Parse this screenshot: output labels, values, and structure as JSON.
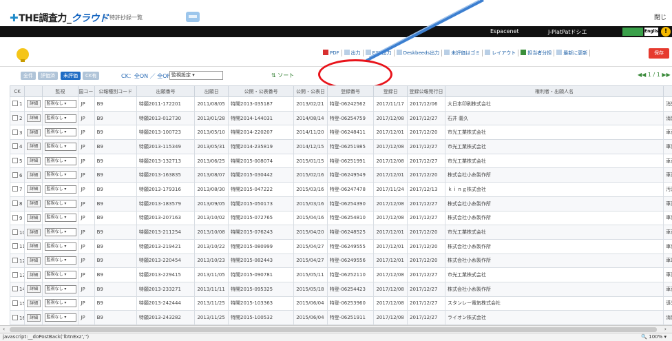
{
  "header": {
    "logo_prefix": "✚",
    "logo_main": "THE調査力_",
    "logo_cloud": "クラウド",
    "subtitle": "特許抄録一覧",
    "close": "閉じ"
  },
  "linkbar": {
    "espacenet": "Espacenet",
    "jplat": "J-PlatPatドシエ",
    "english": "English",
    "help": "!"
  },
  "actions": [
    {
      "icon": "pdf-icon",
      "label": "PDF"
    },
    {
      "icon": "output-icon",
      "label": "出力"
    },
    {
      "icon": "exz-icon",
      "label": "EXZ出力"
    },
    {
      "icon": "deskbeeds-icon",
      "label": "Deskbeeds出力"
    },
    {
      "icon": "trash-icon",
      "label": "未評価はゴミ"
    },
    {
      "icon": "layout-icon",
      "label": "レイアウト"
    },
    {
      "icon": "report-icon",
      "label": "担当者分担"
    },
    {
      "icon": "refresh-icon",
      "label": "最新に更新"
    }
  ],
  "save_label": "保存",
  "filter": {
    "tabs": [
      "全件",
      "評価済",
      "未評価",
      "CK有"
    ],
    "active_tab": "未評価",
    "ck_on": "CK：全ON",
    "ck_off": "全OFF",
    "ck_select": "監視設定",
    "sort": "ソート",
    "pager": "1 / 1"
  },
  "table": {
    "headers": [
      "CK",
      "",
      "監視",
      "国コード",
      "公報種別コード",
      "出願番号",
      "出願日",
      "公開・公表番号",
      "公開・公表日",
      "登録番号",
      "登録日",
      "登録公報発行日",
      "権利者・出願人名",
      ""
    ],
    "detail_label": "詳細",
    "watch_label": "監視なし",
    "rows": [
      [
        "1",
        "JP",
        "B9",
        "特願2011-172201",
        "2011/08/05",
        "特開2013-035187",
        "2013/02/21",
        "特登-06242562",
        "2017/11/17",
        "2017/12/06",
        "大日本印刷株式会社",
        "消臭性能を有"
      ],
      [
        "2",
        "JP",
        "B9",
        "特願2013-012730",
        "2013/01/28",
        "特開2014-144031",
        "2014/08/14",
        "特登-06254759",
        "2017/12/08",
        "2017/12/27",
        "石井 義久",
        "消臭除菌装置"
      ],
      [
        "3",
        "JP",
        "B9",
        "特願2013-100723",
        "2013/05/10",
        "特開2014-220207",
        "2014/11/20",
        "特登-06248411",
        "2017/12/01",
        "2017/12/20",
        "市光工業株式会社",
        "車両用灯具"
      ],
      [
        "4",
        "JP",
        "B9",
        "特願2013-115349",
        "2013/05/31",
        "特開2014-235819",
        "2014/12/15",
        "特登-06251985",
        "2017/12/08",
        "2017/12/27",
        "市光工業株式会社",
        "車両用灯具"
      ],
      [
        "5",
        "JP",
        "B9",
        "特願2013-132713",
        "2013/06/25",
        "特開2015-008074",
        "2015/01/15",
        "特登-06251991",
        "2017/12/08",
        "2017/12/27",
        "市光工業株式会社",
        "車両用灯具の"
      ],
      [
        "6",
        "JP",
        "B9",
        "特願2013-163835",
        "2013/08/07",
        "特開2015-030442",
        "2015/02/16",
        "特登-06249549",
        "2017/12/01",
        "2017/12/20",
        "株式会社小糸製作所",
        "車両用灯具"
      ],
      [
        "7",
        "JP",
        "B9",
        "特願2013-179316",
        "2013/08/30",
        "特開2015-047222",
        "2015/03/16",
        "特登-06247478",
        "2017/11/24",
        "2017/12/13",
        "ｋｉｎｇ株式会社",
        "汚泥スラリー"
      ],
      [
        "8",
        "JP",
        "B9",
        "特願2013-183579",
        "2013/09/05",
        "特開2015-050173",
        "2015/03/16",
        "特登-06254390",
        "2017/12/08",
        "2017/12/27",
        "株式会社小糸製作所",
        "車両用ランプ"
      ],
      [
        "9",
        "JP",
        "B9",
        "特願2013-207163",
        "2013/10/02",
        "特開2015-072765",
        "2015/04/16",
        "特登-06254810",
        "2017/12/08",
        "2017/12/27",
        "株式会社小糸製作所",
        "車両用前照灯"
      ],
      [
        "10",
        "JP",
        "B9",
        "特願2013-211254",
        "2013/10/08",
        "特開2015-076243",
        "2015/04/20",
        "特登-06248525",
        "2017/12/01",
        "2017/12/20",
        "市光工業株式会社",
        "車両用照明灯"
      ],
      [
        "11",
        "JP",
        "B9",
        "特願2013-219421",
        "2013/10/22",
        "特開2015-080999",
        "2015/04/27",
        "特登-06249555",
        "2017/12/01",
        "2017/12/20",
        "株式会社小糸製作所",
        "車両用灯具"
      ],
      [
        "12",
        "JP",
        "B9",
        "特願2013-220454",
        "2013/10/23",
        "特開2015-082443",
        "2015/04/27",
        "特登-06249556",
        "2017/12/01",
        "2017/12/20",
        "株式会社小糸製作所",
        "車載用灯具"
      ],
      [
        "13",
        "JP",
        "B9",
        "特願2013-229415",
        "2013/11/05",
        "特開2015-090781",
        "2015/05/11",
        "特登-06252110",
        "2017/12/08",
        "2017/12/27",
        "市光工業株式会社",
        "車両用灯具"
      ],
      [
        "14",
        "JP",
        "B9",
        "特願2013-233271",
        "2013/11/11",
        "特開2015-095325",
        "2015/05/18",
        "特登-06254423",
        "2017/12/08",
        "2017/12/27",
        "株式会社小糸製作所",
        "車両用灯具"
      ],
      [
        "15",
        "JP",
        "B9",
        "特願2013-242444",
        "2013/11/25",
        "特開2015-103363",
        "2015/06/04",
        "特登-06253960",
        "2017/12/08",
        "2017/12/27",
        "スタンレー電気株式会社",
        "導光板及び車"
      ],
      [
        "16",
        "JP",
        "B9",
        "特願2013-243282",
        "2013/11/25",
        "特開2015-100532",
        "2015/06/04",
        "特登-06251911",
        "2017/12/08",
        "2017/12/27",
        "ライオン株式会社",
        "消臭剤組成物"
      ]
    ]
  },
  "statusbar": {
    "url": "javascript:__doPostBack('lbtnExz','')",
    "zoom": "100%"
  },
  "colors": {
    "annotation_red": "#e8131a",
    "annotation_arrow": "#3c7fd0",
    "active_tab": "#1f6cc4"
  }
}
